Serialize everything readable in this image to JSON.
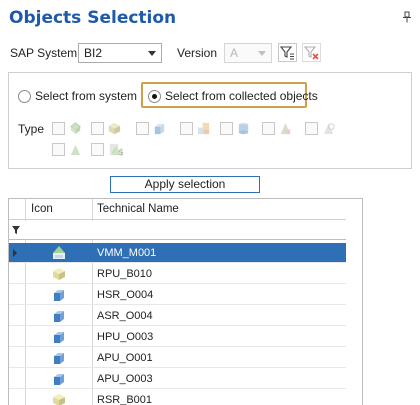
{
  "header": {
    "title": "Objects Selection"
  },
  "filters": {
    "sap_system_label": "SAP System",
    "sap_system_value": "BI2",
    "version_label": "Version",
    "version_value": "A"
  },
  "source": {
    "option_system": "Select from system",
    "option_collected": "Select from collected objects",
    "selected": "collected"
  },
  "type": {
    "label": "Type",
    "icons": [
      "cube-multi-icon",
      "dso-icon",
      "infocube-icon",
      "infoobject-icon",
      "composite-icon",
      "database-icon",
      "transformation-icon",
      "multiprovider-icon",
      "datasource-icon",
      "dtp-icon",
      "currency-icon"
    ]
  },
  "actions": {
    "apply_label": "Apply selection"
  },
  "table": {
    "columns": [
      "Icon",
      "Technical Name"
    ],
    "rows": [
      {
        "icon": "multiprovider-icon",
        "name": "VMM_M001",
        "selected": true
      },
      {
        "icon": "dso-icon",
        "name": "RPU_B010",
        "selected": false
      },
      {
        "icon": "infocube-icon",
        "name": "HSR_O004",
        "selected": false
      },
      {
        "icon": "infocube-icon",
        "name": "ASR_O004",
        "selected": false
      },
      {
        "icon": "infocube-icon",
        "name": "HPU_O003",
        "selected": false
      },
      {
        "icon": "infocube-icon",
        "name": "APU_O001",
        "selected": false
      },
      {
        "icon": "infocube-icon",
        "name": "APU_O003",
        "selected": false
      },
      {
        "icon": "dso-icon",
        "name": "RSR_B001",
        "selected": false
      }
    ]
  },
  "colors": {
    "accent": "#1e5aa8",
    "selection": "#2f6fb5",
    "highlight_frame": "#c9a24b"
  }
}
